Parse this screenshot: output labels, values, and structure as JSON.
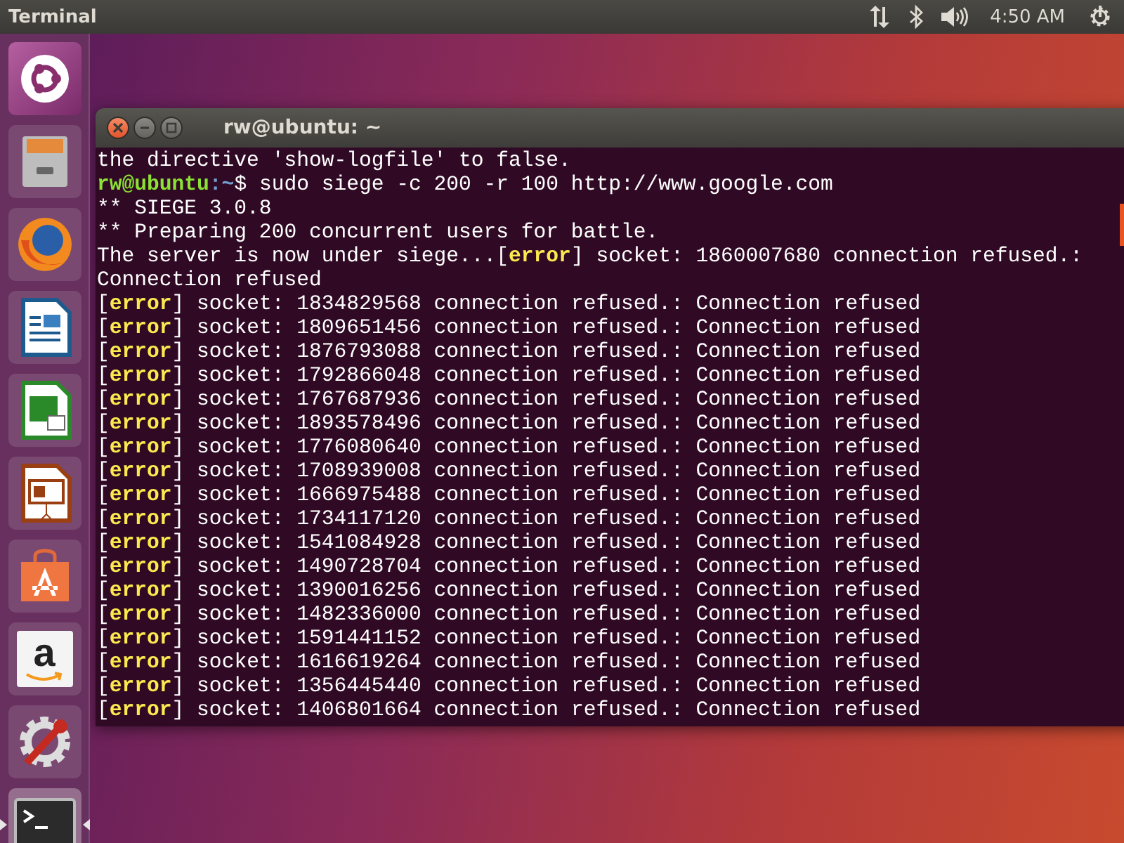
{
  "top_bar": {
    "app_title": "Terminal",
    "clock": "4:50 AM"
  },
  "launcher": [
    {
      "kind": "ubuntu",
      "active": false
    },
    {
      "kind": "files",
      "active": false
    },
    {
      "kind": "firefox",
      "active": false
    },
    {
      "kind": "writer",
      "active": false
    },
    {
      "kind": "calc",
      "active": false
    },
    {
      "kind": "impress",
      "active": false
    },
    {
      "kind": "store",
      "active": false
    },
    {
      "kind": "amazon",
      "active": false,
      "glyph": "a"
    },
    {
      "kind": "settings",
      "active": false
    },
    {
      "kind": "terminal",
      "active": true
    }
  ],
  "window": {
    "title": "rw@ubuntu: ~",
    "lines": [
      {
        "segments": [
          {
            "kind": "plain",
            "text": "the directive 'show-logfile' to false."
          }
        ]
      },
      {
        "segments": [
          {
            "kind": "user",
            "text": "rw@ubuntu"
          },
          {
            "kind": "path",
            "text": ":~"
          },
          {
            "kind": "plain",
            "text": "$ sudo siege -c 200 -r 100 http://www.google.com"
          }
        ]
      },
      {
        "segments": [
          {
            "kind": "plain",
            "text": "** SIEGE 3.0.8"
          }
        ]
      },
      {
        "segments": [
          {
            "kind": "plain",
            "text": "** Preparing 200 concurrent users for battle."
          }
        ]
      },
      {
        "segments": [
          {
            "kind": "plain",
            "text": "The server is now under siege...["
          },
          {
            "kind": "error",
            "text": "error"
          },
          {
            "kind": "plain",
            "text": "] socket: 1860007680 connection refused.:"
          }
        ]
      },
      {
        "segments": [
          {
            "kind": "plain",
            "text": "Connection refused"
          }
        ]
      },
      {
        "segments": [
          {
            "kind": "plain",
            "text": "["
          },
          {
            "kind": "error",
            "text": "error"
          },
          {
            "kind": "plain",
            "text": "] socket: 1834829568 connection refused.: Connection refused"
          }
        ]
      },
      {
        "segments": [
          {
            "kind": "plain",
            "text": "["
          },
          {
            "kind": "error",
            "text": "error"
          },
          {
            "kind": "plain",
            "text": "] socket: 1809651456 connection refused.: Connection refused"
          }
        ]
      },
      {
        "segments": [
          {
            "kind": "plain",
            "text": "["
          },
          {
            "kind": "error",
            "text": "error"
          },
          {
            "kind": "plain",
            "text": "] socket: 1876793088 connection refused.: Connection refused"
          }
        ]
      },
      {
        "segments": [
          {
            "kind": "plain",
            "text": "["
          },
          {
            "kind": "error",
            "text": "error"
          },
          {
            "kind": "plain",
            "text": "] socket: 1792866048 connection refused.: Connection refused"
          }
        ]
      },
      {
        "segments": [
          {
            "kind": "plain",
            "text": "["
          },
          {
            "kind": "error",
            "text": "error"
          },
          {
            "kind": "plain",
            "text": "] socket: 1767687936 connection refused.: Connection refused"
          }
        ]
      },
      {
        "segments": [
          {
            "kind": "plain",
            "text": "["
          },
          {
            "kind": "error",
            "text": "error"
          },
          {
            "kind": "plain",
            "text": "] socket: 1893578496 connection refused.: Connection refused"
          }
        ]
      },
      {
        "segments": [
          {
            "kind": "plain",
            "text": "["
          },
          {
            "kind": "error",
            "text": "error"
          },
          {
            "kind": "plain",
            "text": "] socket: 1776080640 connection refused.: Connection refused"
          }
        ]
      },
      {
        "segments": [
          {
            "kind": "plain",
            "text": "["
          },
          {
            "kind": "error",
            "text": "error"
          },
          {
            "kind": "plain",
            "text": "] socket: 1708939008 connection refused.: Connection refused"
          }
        ]
      },
      {
        "segments": [
          {
            "kind": "plain",
            "text": "["
          },
          {
            "kind": "error",
            "text": "error"
          },
          {
            "kind": "plain",
            "text": "] socket: 1666975488 connection refused.: Connection refused"
          }
        ]
      },
      {
        "segments": [
          {
            "kind": "plain",
            "text": "["
          },
          {
            "kind": "error",
            "text": "error"
          },
          {
            "kind": "plain",
            "text": "] socket: 1734117120 connection refused.: Connection refused"
          }
        ]
      },
      {
        "segments": [
          {
            "kind": "plain",
            "text": "["
          },
          {
            "kind": "error",
            "text": "error"
          },
          {
            "kind": "plain",
            "text": "] socket: 1541084928 connection refused.: Connection refused"
          }
        ]
      },
      {
        "segments": [
          {
            "kind": "plain",
            "text": "["
          },
          {
            "kind": "error",
            "text": "error"
          },
          {
            "kind": "plain",
            "text": "] socket: 1490728704 connection refused.: Connection refused"
          }
        ]
      },
      {
        "segments": [
          {
            "kind": "plain",
            "text": "["
          },
          {
            "kind": "error",
            "text": "error"
          },
          {
            "kind": "plain",
            "text": "] socket: 1390016256 connection refused.: Connection refused"
          }
        ]
      },
      {
        "segments": [
          {
            "kind": "plain",
            "text": "["
          },
          {
            "kind": "error",
            "text": "error"
          },
          {
            "kind": "plain",
            "text": "] socket: 1482336000 connection refused.: Connection refused"
          }
        ]
      },
      {
        "segments": [
          {
            "kind": "plain",
            "text": "["
          },
          {
            "kind": "error",
            "text": "error"
          },
          {
            "kind": "plain",
            "text": "] socket: 1591441152 connection refused.: Connection refused"
          }
        ]
      },
      {
        "segments": [
          {
            "kind": "plain",
            "text": "["
          },
          {
            "kind": "error",
            "text": "error"
          },
          {
            "kind": "plain",
            "text": "] socket: 1616619264 connection refused.: Connection refused"
          }
        ]
      },
      {
        "segments": [
          {
            "kind": "plain",
            "text": "["
          },
          {
            "kind": "error",
            "text": "error"
          },
          {
            "kind": "plain",
            "text": "] socket: 1356445440 connection refused.: Connection refused"
          }
        ]
      },
      {
        "segments": [
          {
            "kind": "plain",
            "text": "["
          },
          {
            "kind": "error",
            "text": "error"
          },
          {
            "kind": "plain",
            "text": "] socket: 1406801664 connection refused.: Connection refused"
          }
        ]
      }
    ]
  }
}
